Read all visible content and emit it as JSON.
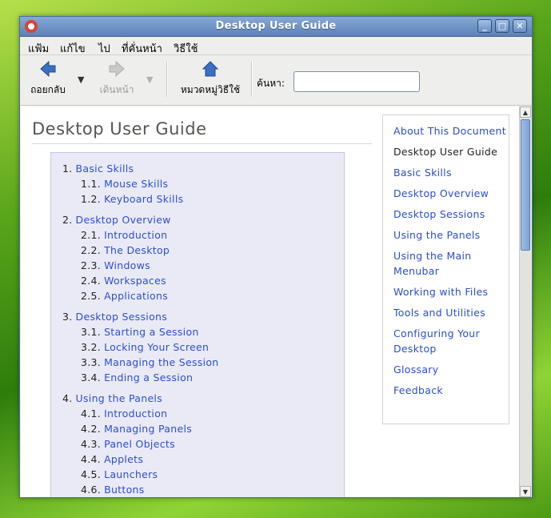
{
  "window": {
    "title": "Desktop User Guide",
    "controls": {
      "minimize": "_",
      "maximize": "□",
      "close": "✕"
    }
  },
  "menubar": {
    "items": [
      "แฟ้ม",
      "แก้ไข",
      "ไป",
      "ที่คั่นหน้า",
      "วิธีใช้"
    ]
  },
  "toolbar": {
    "back_label": "ถอยกลับ",
    "forward_label": "เดินหน้า",
    "contents_label": "หมวดหมู่วิธีใช้",
    "search_label": "ค้นหา:",
    "search_value": ""
  },
  "page": {
    "title": "Desktop User Guide",
    "toc": [
      {
        "num": "1.",
        "label": "Basic Skills",
        "items": [
          {
            "num": "1.1.",
            "label": "Mouse Skills"
          },
          {
            "num": "1.2.",
            "label": "Keyboard Skills"
          }
        ]
      },
      {
        "num": "2.",
        "label": "Desktop Overview",
        "items": [
          {
            "num": "2.1.",
            "label": "Introduction"
          },
          {
            "num": "2.2.",
            "label": "The Desktop"
          },
          {
            "num": "2.3.",
            "label": "Windows"
          },
          {
            "num": "2.4.",
            "label": "Workspaces"
          },
          {
            "num": "2.5.",
            "label": "Applications"
          }
        ]
      },
      {
        "num": "3.",
        "label": "Desktop Sessions",
        "items": [
          {
            "num": "3.1.",
            "label": "Starting a Session"
          },
          {
            "num": "3.2.",
            "label": "Locking Your Screen"
          },
          {
            "num": "3.3.",
            "label": "Managing the Session"
          },
          {
            "num": "3.4.",
            "label": "Ending a Session"
          }
        ]
      },
      {
        "num": "4.",
        "label": "Using the Panels",
        "items": [
          {
            "num": "4.1.",
            "label": "Introduction"
          },
          {
            "num": "4.2.",
            "label": "Managing Panels"
          },
          {
            "num": "4.3.",
            "label": "Panel Objects"
          },
          {
            "num": "4.4.",
            "label": "Applets"
          },
          {
            "num": "4.5.",
            "label": "Launchers"
          },
          {
            "num": "4.6.",
            "label": "Buttons"
          }
        ]
      }
    ]
  },
  "sidebar": {
    "items": [
      {
        "label": "About This Document",
        "current": false
      },
      {
        "label": "Desktop User Guide",
        "current": true
      },
      {
        "label": "Basic Skills",
        "current": false
      },
      {
        "label": "Desktop Overview",
        "current": false
      },
      {
        "label": "Desktop Sessions",
        "current": false
      },
      {
        "label": "Using the Panels",
        "current": false
      },
      {
        "label": "Using the Main Menubar",
        "current": false
      },
      {
        "label": "Working with Files",
        "current": false
      },
      {
        "label": "Tools and Utilities",
        "current": false
      },
      {
        "label": "Configuring Your Desktop",
        "current": false
      },
      {
        "label": "Glossary",
        "current": false
      },
      {
        "label": "Feedback",
        "current": false
      }
    ]
  },
  "colors": {
    "link": "#2a4fd1",
    "titlebar": "#6f93c8",
    "toc_bg": "#eaeaf7"
  }
}
